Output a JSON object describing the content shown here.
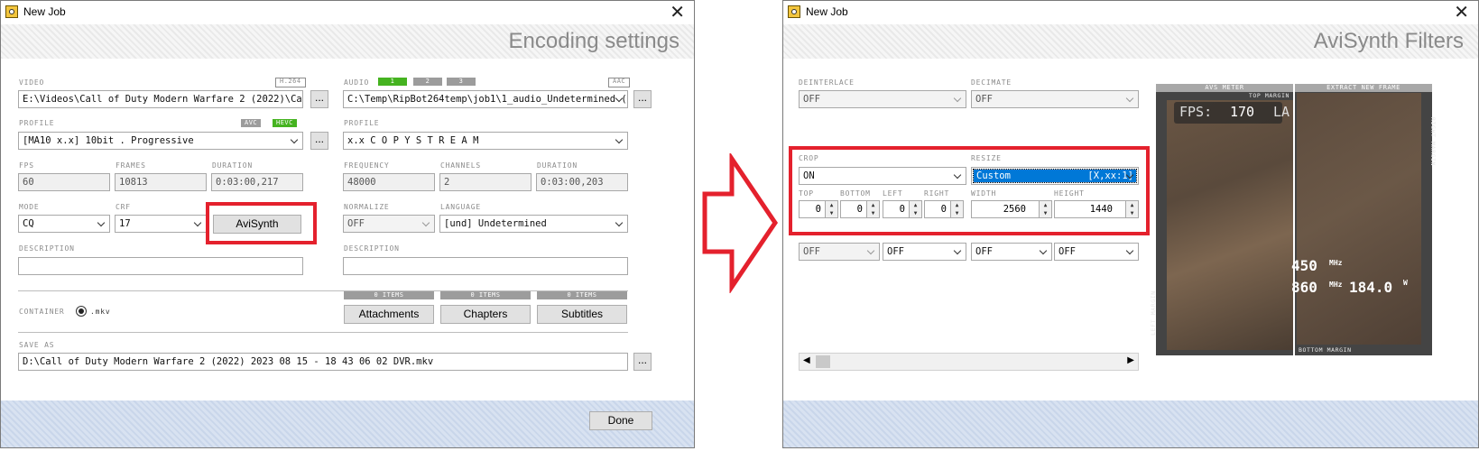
{
  "left": {
    "title": "New Job",
    "header": "Encoding settings",
    "video": {
      "label": "VIDEO",
      "codec_badge": "H.264",
      "path": "E:\\Videos\\Call of Duty  Modern Warfare 2 (2022)\\Call of",
      "browse": "...",
      "profile_label": "PROFILE",
      "badges": [
        "AVC",
        "HEVC"
      ],
      "profile": "[MA10 x.x] 10bit . Progressive",
      "fps_label": "FPS",
      "fps": "60",
      "frames_label": "FRAMES",
      "frames": "10813",
      "duration_label": "DURATION",
      "duration": "0:03:00,217",
      "mode_label": "MODE",
      "mode": "CQ",
      "crf_label": "CRF",
      "crf": "17",
      "avisynth_button": "AviSynth",
      "description_label": "DESCRIPTION",
      "description": ""
    },
    "audio": {
      "label": "AUDIO",
      "tracks": [
        "1",
        "2",
        "3"
      ],
      "codec_badge": "AAC",
      "path": "C:\\Temp\\RipBot264temp\\job1\\1_audio_Undetermined (un",
      "browse": "...",
      "profile_label": "PROFILE",
      "profile": "x.x C O P Y    S T R E A M",
      "frequency_label": "FREQUENCY",
      "frequency": "48000",
      "channels_label": "CHANNELS",
      "channels": "2",
      "duration_label": "DURATION",
      "duration": "0:03:00,203",
      "normalize_label": "NORMALIZE",
      "normalize": "OFF",
      "language_label": "LANGUAGE",
      "language": "[und] Undetermined",
      "description_label": "DESCRIPTION",
      "description": ""
    },
    "container": {
      "label": "CONTAINER",
      "value": ".mkv"
    },
    "attachments": {
      "count": "0 ITEMS",
      "label": "Attachments"
    },
    "chapters": {
      "count": "0 ITEMS",
      "label": "Chapters"
    },
    "subtitles": {
      "count": "0 ITEMS",
      "label": "Subtitles"
    },
    "save_as": {
      "label": "SAVE AS",
      "path": "D:\\Call of Duty  Modern Warfare 2 (2022) 2023 08 15 - 18 43 06 02 DVR.mkv",
      "browse": "..."
    },
    "done": "Done"
  },
  "right": {
    "title": "New Job",
    "header": "AviSynth Filters",
    "deinterlace_label": "DEINTERLACE",
    "deinterlace": "OFF",
    "decimate_label": "DECIMATE",
    "decimate": "OFF",
    "crop_label": "CROP",
    "crop": "ON",
    "resize_label": "RESIZE",
    "resize": "Custom",
    "resize_ratio": "[X,xx:1]",
    "top_label": "TOP",
    "top": "0",
    "bottom_label": "BOTTOM",
    "bottom": "0",
    "left_label": "LEFT",
    "left": "0",
    "right_label": "RIGHT",
    "right": "0",
    "width_label": "WIDTH",
    "width": "2560",
    "height_label": "HEIGHT",
    "height": "1440",
    "row3": [
      "OFF",
      "OFF",
      "OFF",
      "OFF"
    ],
    "preview": {
      "avs_meter": "AVS METER",
      "extract_frame": "EXTRACT NEW FRAME",
      "top_margin": "TOP MARGIN",
      "right_margin": "RIGHT MARGIN",
      "left_margin": "LEFT MARGIN",
      "bottom_margin": "BOTTOM MARGIN",
      "fps_overlay": "FPS:",
      "fps_value": "170",
      "la_overlay": "LA",
      "mhz1": "450",
      "mhz_unit1": "MHz",
      "mhz2": "860",
      "mhz_unit2": "MHz",
      "watts": "184.0",
      "watt_unit": "W"
    }
  },
  "colors": {
    "highlight": "#e4212d",
    "accent_green": "#45b320",
    "selection_blue": "#0078d7"
  }
}
